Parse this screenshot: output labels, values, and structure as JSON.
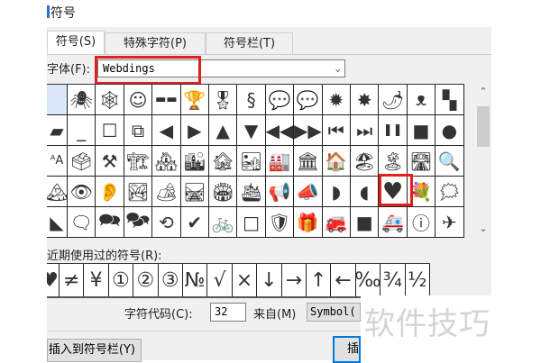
{
  "dialog": {
    "title": "符号"
  },
  "tabs": [
    {
      "label": "符号(S)",
      "active": true
    },
    {
      "label": "特殊字符(P)",
      "active": false
    },
    {
      "label": "符号栏(T)",
      "active": false
    }
  ],
  "font": {
    "label": "字体(F):",
    "value": "Webdings"
  },
  "grid": {
    "rows": [
      [
        {
          "icon": "blank-selected",
          "g": ""
        },
        {
          "icon": "spider-icon",
          "g": "🕷"
        },
        {
          "icon": "spiderweb-icon",
          "g": "🕸"
        },
        {
          "icon": "face-icon",
          "g": "☺"
        },
        {
          "icon": "sunglasses-icon",
          "g": "▬▬"
        },
        {
          "icon": "trophy-icon",
          "g": "🏆"
        },
        {
          "icon": "medal-icon",
          "g": "🎖"
        },
        {
          "icon": "ribbon-scroll-icon",
          "g": "§"
        },
        {
          "icon": "speech-bubble-icon",
          "g": "💬"
        },
        {
          "icon": "speech-bubble-icon",
          "g": "💬"
        },
        {
          "icon": "burst-icon",
          "g": "✹"
        },
        {
          "icon": "burst-lightning-icon",
          "g": "✸"
        },
        {
          "icon": "chili-icon",
          "g": "🌶"
        },
        {
          "icon": "awareness-ribbon-icon",
          "g": "ᴥ"
        },
        {
          "icon": "checker-squares-icon",
          "g": "▚"
        }
      ],
      [
        {
          "icon": "parallelogram-icon",
          "g": "▰"
        },
        {
          "icon": "minimize-icon",
          "g": "_"
        },
        {
          "icon": "maximize-icon",
          "g": "☐"
        },
        {
          "icon": "restore-icon",
          "g": "⧉"
        },
        {
          "icon": "triangle-left-icon",
          "g": "◀"
        },
        {
          "icon": "triangle-right-icon",
          "g": "▶"
        },
        {
          "icon": "triangle-up-icon",
          "g": "▲"
        },
        {
          "icon": "triangle-down-icon",
          "g": "▼"
        },
        {
          "icon": "rewind-icon",
          "g": "◀◀"
        },
        {
          "icon": "fast-forward-icon",
          "g": "▶▶"
        },
        {
          "icon": "skip-back-icon",
          "g": "⏮"
        },
        {
          "icon": "skip-forward-icon",
          "g": "⏭"
        },
        {
          "icon": "pause-icon",
          "g": "❚❚"
        },
        {
          "icon": "stop-icon",
          "g": "■"
        },
        {
          "icon": "record-icon",
          "g": "●"
        }
      ],
      [
        {
          "icon": "text-size-icon",
          "g": "ᴬA"
        },
        {
          "icon": "ballot-box-icon",
          "g": "🗳"
        },
        {
          "icon": "tools-icon",
          "g": "⚒"
        },
        {
          "icon": "building-construction-icon",
          "g": "🏗"
        },
        {
          "icon": "houses-icon",
          "g": "🏘"
        },
        {
          "icon": "city-icon",
          "g": "🏙"
        },
        {
          "icon": "derelict-house-icon",
          "g": "🏚"
        },
        {
          "icon": "desert-icon",
          "g": "🏜"
        },
        {
          "icon": "factory-icon",
          "g": "🏭"
        },
        {
          "icon": "classical-building-icon",
          "g": "🏛"
        },
        {
          "icon": "house-icon",
          "g": "🏠"
        },
        {
          "icon": "beach-umbrella-icon",
          "g": "🏖"
        },
        {
          "icon": "desert-island-icon",
          "g": "🏝"
        },
        {
          "icon": "motorway-icon",
          "g": "🛣"
        },
        {
          "icon": "magnifier-icon",
          "g": "🔍"
        }
      ],
      [
        {
          "icon": "mountain-icon",
          "g": "🏔"
        },
        {
          "icon": "eye-icon",
          "g": "👁"
        },
        {
          "icon": "ear-icon",
          "g": "👂"
        },
        {
          "icon": "national-park-icon",
          "g": "🏞"
        },
        {
          "icon": "camping-icon",
          "g": "🏕"
        },
        {
          "icon": "railway-track-icon",
          "g": "🛤"
        },
        {
          "icon": "stadium-icon",
          "g": "🏟"
        },
        {
          "icon": "cruise-ship-icon",
          "g": "🛳"
        },
        {
          "icon": "loudspeaker-icon",
          "g": "📢"
        },
        {
          "icon": "megaphone-icon",
          "g": "📣"
        },
        {
          "icon": "speaker-right-icon",
          "g": "◗"
        },
        {
          "icon": "speaker-left-icon",
          "g": "◖"
        },
        {
          "icon": "heart-icon",
          "g": "♥"
        },
        {
          "icon": "bouquet-icon",
          "g": "💐"
        },
        {
          "icon": "thought-bubble-icon",
          "g": "🗯"
        }
      ],
      [
        {
          "icon": "slash-shape-icon",
          "g": "◣"
        },
        {
          "icon": "speech-bubble-left-icon",
          "g": "🗨"
        },
        {
          "icon": "two-bubbles-icon",
          "g": "🗪"
        },
        {
          "icon": "three-bubbles-icon",
          "g": "🗫"
        },
        {
          "icon": "refresh-box-icon",
          "g": "⟲"
        },
        {
          "icon": "check-icon",
          "g": "✔"
        },
        {
          "icon": "bicycle-icon",
          "g": "🚲"
        },
        {
          "icon": "white-square-icon",
          "g": "□"
        },
        {
          "icon": "shield-icon",
          "g": "🛡"
        },
        {
          "icon": "gift-icon",
          "g": "🎁"
        },
        {
          "icon": "fire-engine-icon",
          "g": "🚒"
        },
        {
          "icon": "black-square-icon",
          "g": "■"
        },
        {
          "icon": "ambulance-icon",
          "g": "🚑"
        },
        {
          "icon": "info-icon",
          "g": "ⓘ"
        },
        {
          "icon": "airplane-icon",
          "g": "✈"
        }
      ]
    ]
  },
  "recent": {
    "label": "近期使用过的符号(R):",
    "items": [
      "♥",
      "≠",
      "¥",
      "①",
      "②",
      "③",
      "№",
      "√",
      "×",
      "↓",
      "→",
      "↑",
      "←",
      "‰",
      "¾",
      "½"
    ]
  },
  "char_code": {
    "label": "字符代码(C):",
    "value": "32"
  },
  "from": {
    "label": "来自(M)",
    "value": "Symbol("
  },
  "buttons": {
    "add_to_toolbar": "插入到符号栏(Y)",
    "insert": "插"
  },
  "watermark": "软件技巧",
  "colors": {
    "highlight": "#e02020",
    "selected": "#dce8f8"
  }
}
